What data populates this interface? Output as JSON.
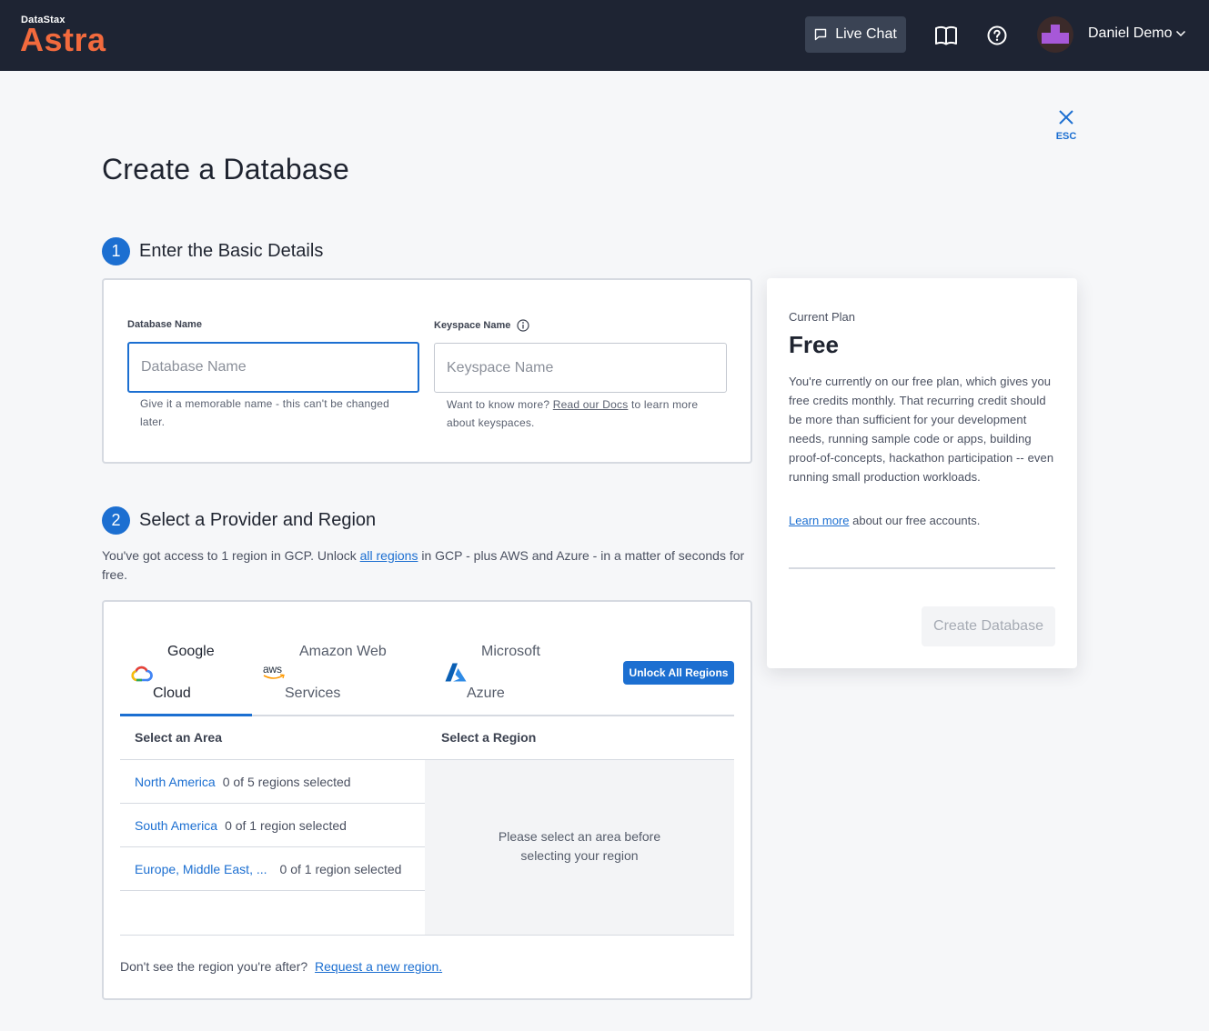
{
  "header": {
    "brand_small": "DataStax",
    "brand_name": "Astra",
    "live_chat_label": "Live Chat",
    "user_name": "Daniel Demo",
    "colors": {
      "bar": "#1e2433",
      "brand": "#f26a3d",
      "accent": "#1c6fd1"
    }
  },
  "close": {
    "label": "ESC"
  },
  "page_title": "Create a Database",
  "step1": {
    "number": "1",
    "title": "Enter the Basic Details",
    "db_name": {
      "label": "Database Name",
      "placeholder": "Database Name",
      "helper": "Give it a memorable name - this can't be changed later."
    },
    "keyspace": {
      "label": "Keyspace Name",
      "placeholder": "Keyspace Name",
      "helper_before": "Want to know more?",
      "helper_link": "Read our Docs",
      "helper_after": "to learn more about keyspaces."
    }
  },
  "step2": {
    "number": "2",
    "title": "Select a Provider and Region",
    "intro_before": "You've got access to 1 region in GCP. Unlock",
    "intro_link": "all regions",
    "intro_after": "in GCP - plus AWS and Azure - in a matter of seconds for free.",
    "tabs": [
      {
        "line1": "Google",
        "line2": "Cloud",
        "icon": "google-cloud-icon",
        "active": true
      },
      {
        "line1": "Amazon Web",
        "line2": "Services",
        "icon": "aws-icon",
        "icon_text": "aws",
        "active": false
      },
      {
        "line1": "Microsoft",
        "line2": "Azure",
        "icon": "azure-icon",
        "active": false
      }
    ],
    "unlock_label": "Unlock All Regions",
    "area_header": "Select an Area",
    "region_header": "Select a Region",
    "areas": [
      {
        "name": "North America",
        "count": "0 of 5 regions selected"
      },
      {
        "name": "South America",
        "count": "0 of 1 region selected"
      },
      {
        "name": "Europe, Middle East, ...",
        "count": "0 of 1 region selected"
      }
    ],
    "region_empty": "Please select an area before selecting your region",
    "footer_text": "Don't see the region you're after?",
    "footer_link": "Request a new region."
  },
  "plan": {
    "current_label": "Current Plan",
    "name": "Free",
    "description": "You're currently on our free plan, which gives you free credits monthly. That recurring credit should be more than sufficient for your development needs, running sample code or apps, building proof-of-concepts, hackathon participation -- even running small production workloads.",
    "learn_link": "Learn more",
    "learn_after": "about our free accounts.",
    "create_button": "Create Database"
  }
}
